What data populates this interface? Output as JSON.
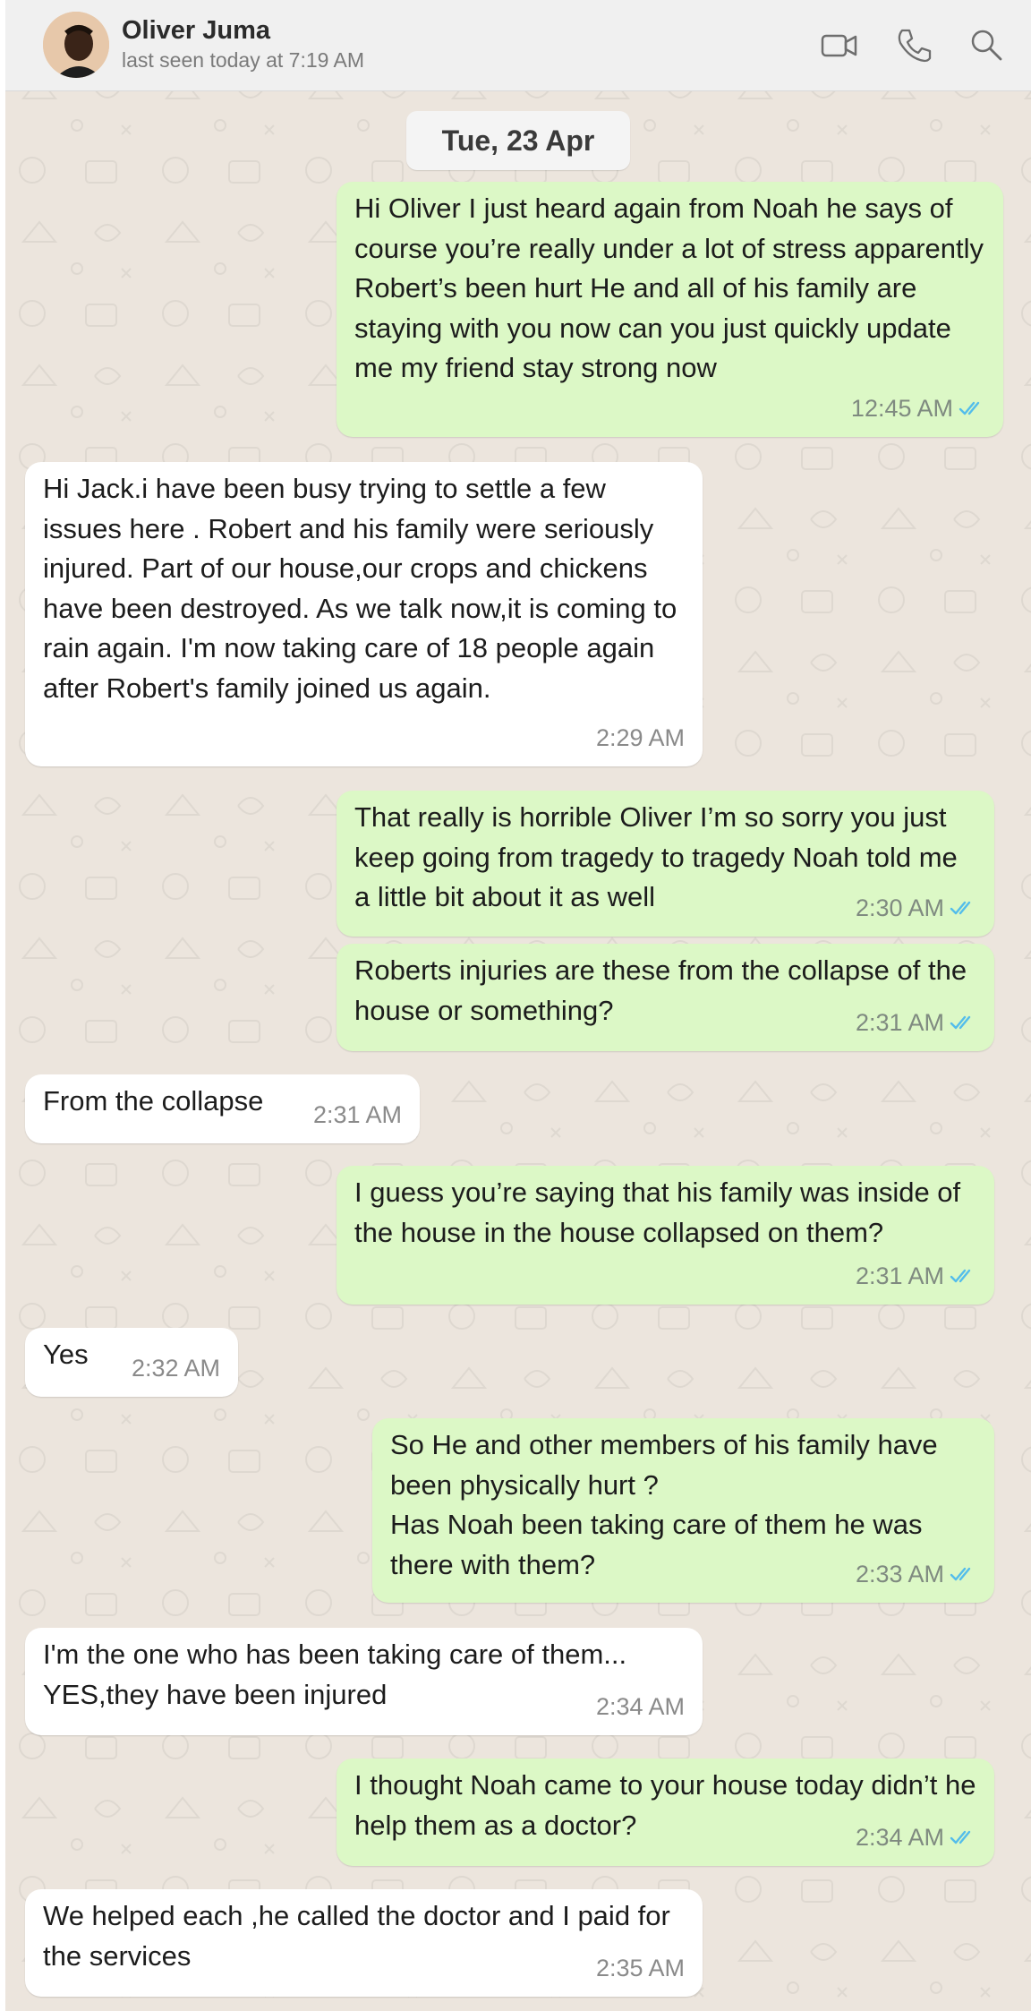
{
  "contact": {
    "name": "Oliver Juma",
    "status": "last seen today at 7:19 AM"
  },
  "header_icons": [
    "video-call-icon",
    "phone-call-icon",
    "search-icon"
  ],
  "date_chip": "Tue, 23 Apr",
  "colors": {
    "outgoing_bubble": "#dcf8c6",
    "incoming_bubble": "#ffffff",
    "chat_background": "#ece5dd",
    "read_ticks": "#53bdeb"
  },
  "messages": [
    {
      "direction": "outgoing",
      "text": "Hi Oliver I just heard again from Noah he says of course you’re really under a lot of stress apparently Robert’s been hurt He and all of his family are staying with you now can you just quickly update me my friend stay strong now",
      "time": "12:45 AM",
      "read": true
    },
    {
      "direction": "incoming",
      "text": "Hi Jack.i have been busy trying to settle a few issues here . Robert and his family were seriously injured. Part of our house,our crops and chickens have been destroyed. As we talk now,it is coming to rain again.  I'm now taking care of 18 people again after Robert's family joined us again.",
      "time": "2:29 AM"
    },
    {
      "direction": "outgoing",
      "text": "That really is horrible Oliver I’m so sorry you just keep going from tragedy to tragedy Noah told me a little bit about it as well",
      "time": "2:30 AM",
      "read": true
    },
    {
      "direction": "outgoing",
      "text": "Roberts injuries are these from the collapse of the house or something?",
      "time": "2:31 AM",
      "read": true
    },
    {
      "direction": "incoming",
      "text": "From the collapse",
      "time": "2:31 AM"
    },
    {
      "direction": "outgoing",
      "text": "I guess you’re saying that his family was inside of the house in the house collapsed on them?",
      "time": "2:31 AM",
      "read": true
    },
    {
      "direction": "incoming",
      "text": "Yes",
      "time": "2:32 AM"
    },
    {
      "direction": "outgoing",
      "text": "So He and other members of his family have been physically hurt ?\nHas Noah been taking care of them he was there with them?",
      "time": "2:33 AM",
      "read": true
    },
    {
      "direction": "incoming",
      "text": "I'm the one who has been taking care of them...\nYES,they have been injured",
      "time": "2:34 AM"
    },
    {
      "direction": "outgoing",
      "text": "I thought Noah came to your house today didn’t he help them as a doctor?",
      "time": "2:34 AM",
      "read": true
    },
    {
      "direction": "incoming",
      "text": "We helped each ,he called the doctor and I paid for the services",
      "time": "2:35 AM"
    }
  ]
}
